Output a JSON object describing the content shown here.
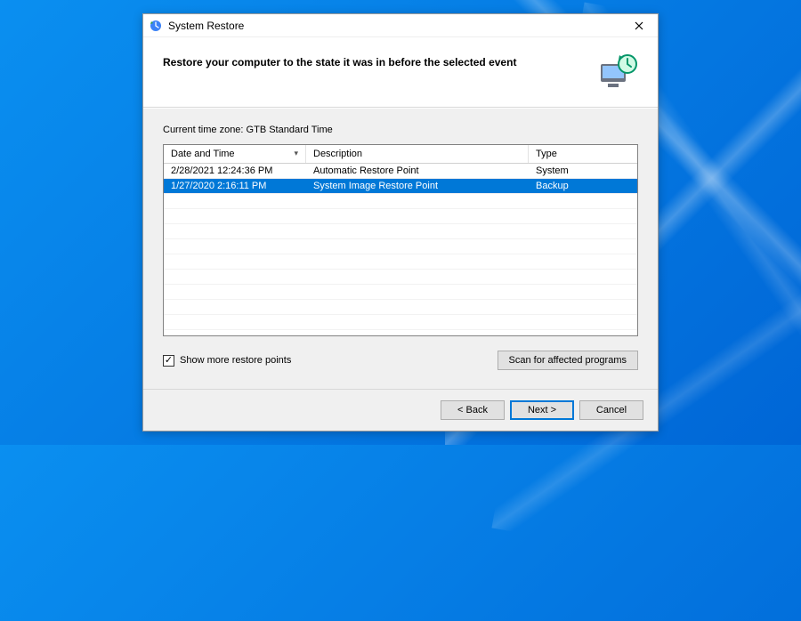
{
  "window": {
    "title": "System Restore",
    "heading": "Restore your computer to the state it was in before the selected event"
  },
  "timezone_label": "Current time zone: GTB Standard Time",
  "columns": {
    "date": "Date and Time",
    "desc": "Description",
    "type": "Type"
  },
  "rows": [
    {
      "date": "2/28/2021 12:24:36 PM",
      "desc": "Automatic Restore Point",
      "type": "System",
      "selected": false
    },
    {
      "date": "1/27/2020 2:16:11 PM",
      "desc": "System Image Restore Point",
      "type": "Backup",
      "selected": true
    }
  ],
  "show_more": {
    "label": "Show more restore points",
    "checked": true
  },
  "scan_button": "Scan for affected programs",
  "footer": {
    "back": "< Back",
    "next": "Next >",
    "cancel": "Cancel"
  }
}
